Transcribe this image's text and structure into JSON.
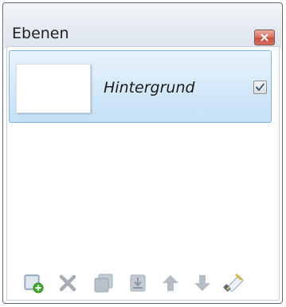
{
  "window": {
    "title": "Ebenen",
    "close_icon": "close-icon"
  },
  "layers": [
    {
      "name": "Hintergrund",
      "visible": true,
      "selected": true
    }
  ],
  "toolbar": {
    "buttons": [
      {
        "icon": "add-layer-icon",
        "enabled": true
      },
      {
        "icon": "delete-layer-icon",
        "enabled": false
      },
      {
        "icon": "duplicate-layer-icon",
        "enabled": false
      },
      {
        "icon": "merge-layer-down-icon",
        "enabled": false
      },
      {
        "icon": "move-layer-up-icon",
        "enabled": false
      },
      {
        "icon": "move-layer-down-icon",
        "enabled": false
      },
      {
        "icon": "layer-properties-icon",
        "enabled": true
      }
    ]
  },
  "colors": {
    "selection_border": "#7ab5e8",
    "selection_fill": "#d4e8f9",
    "close_button": "#d9786a",
    "add_icon_green": "#3fae2a"
  }
}
